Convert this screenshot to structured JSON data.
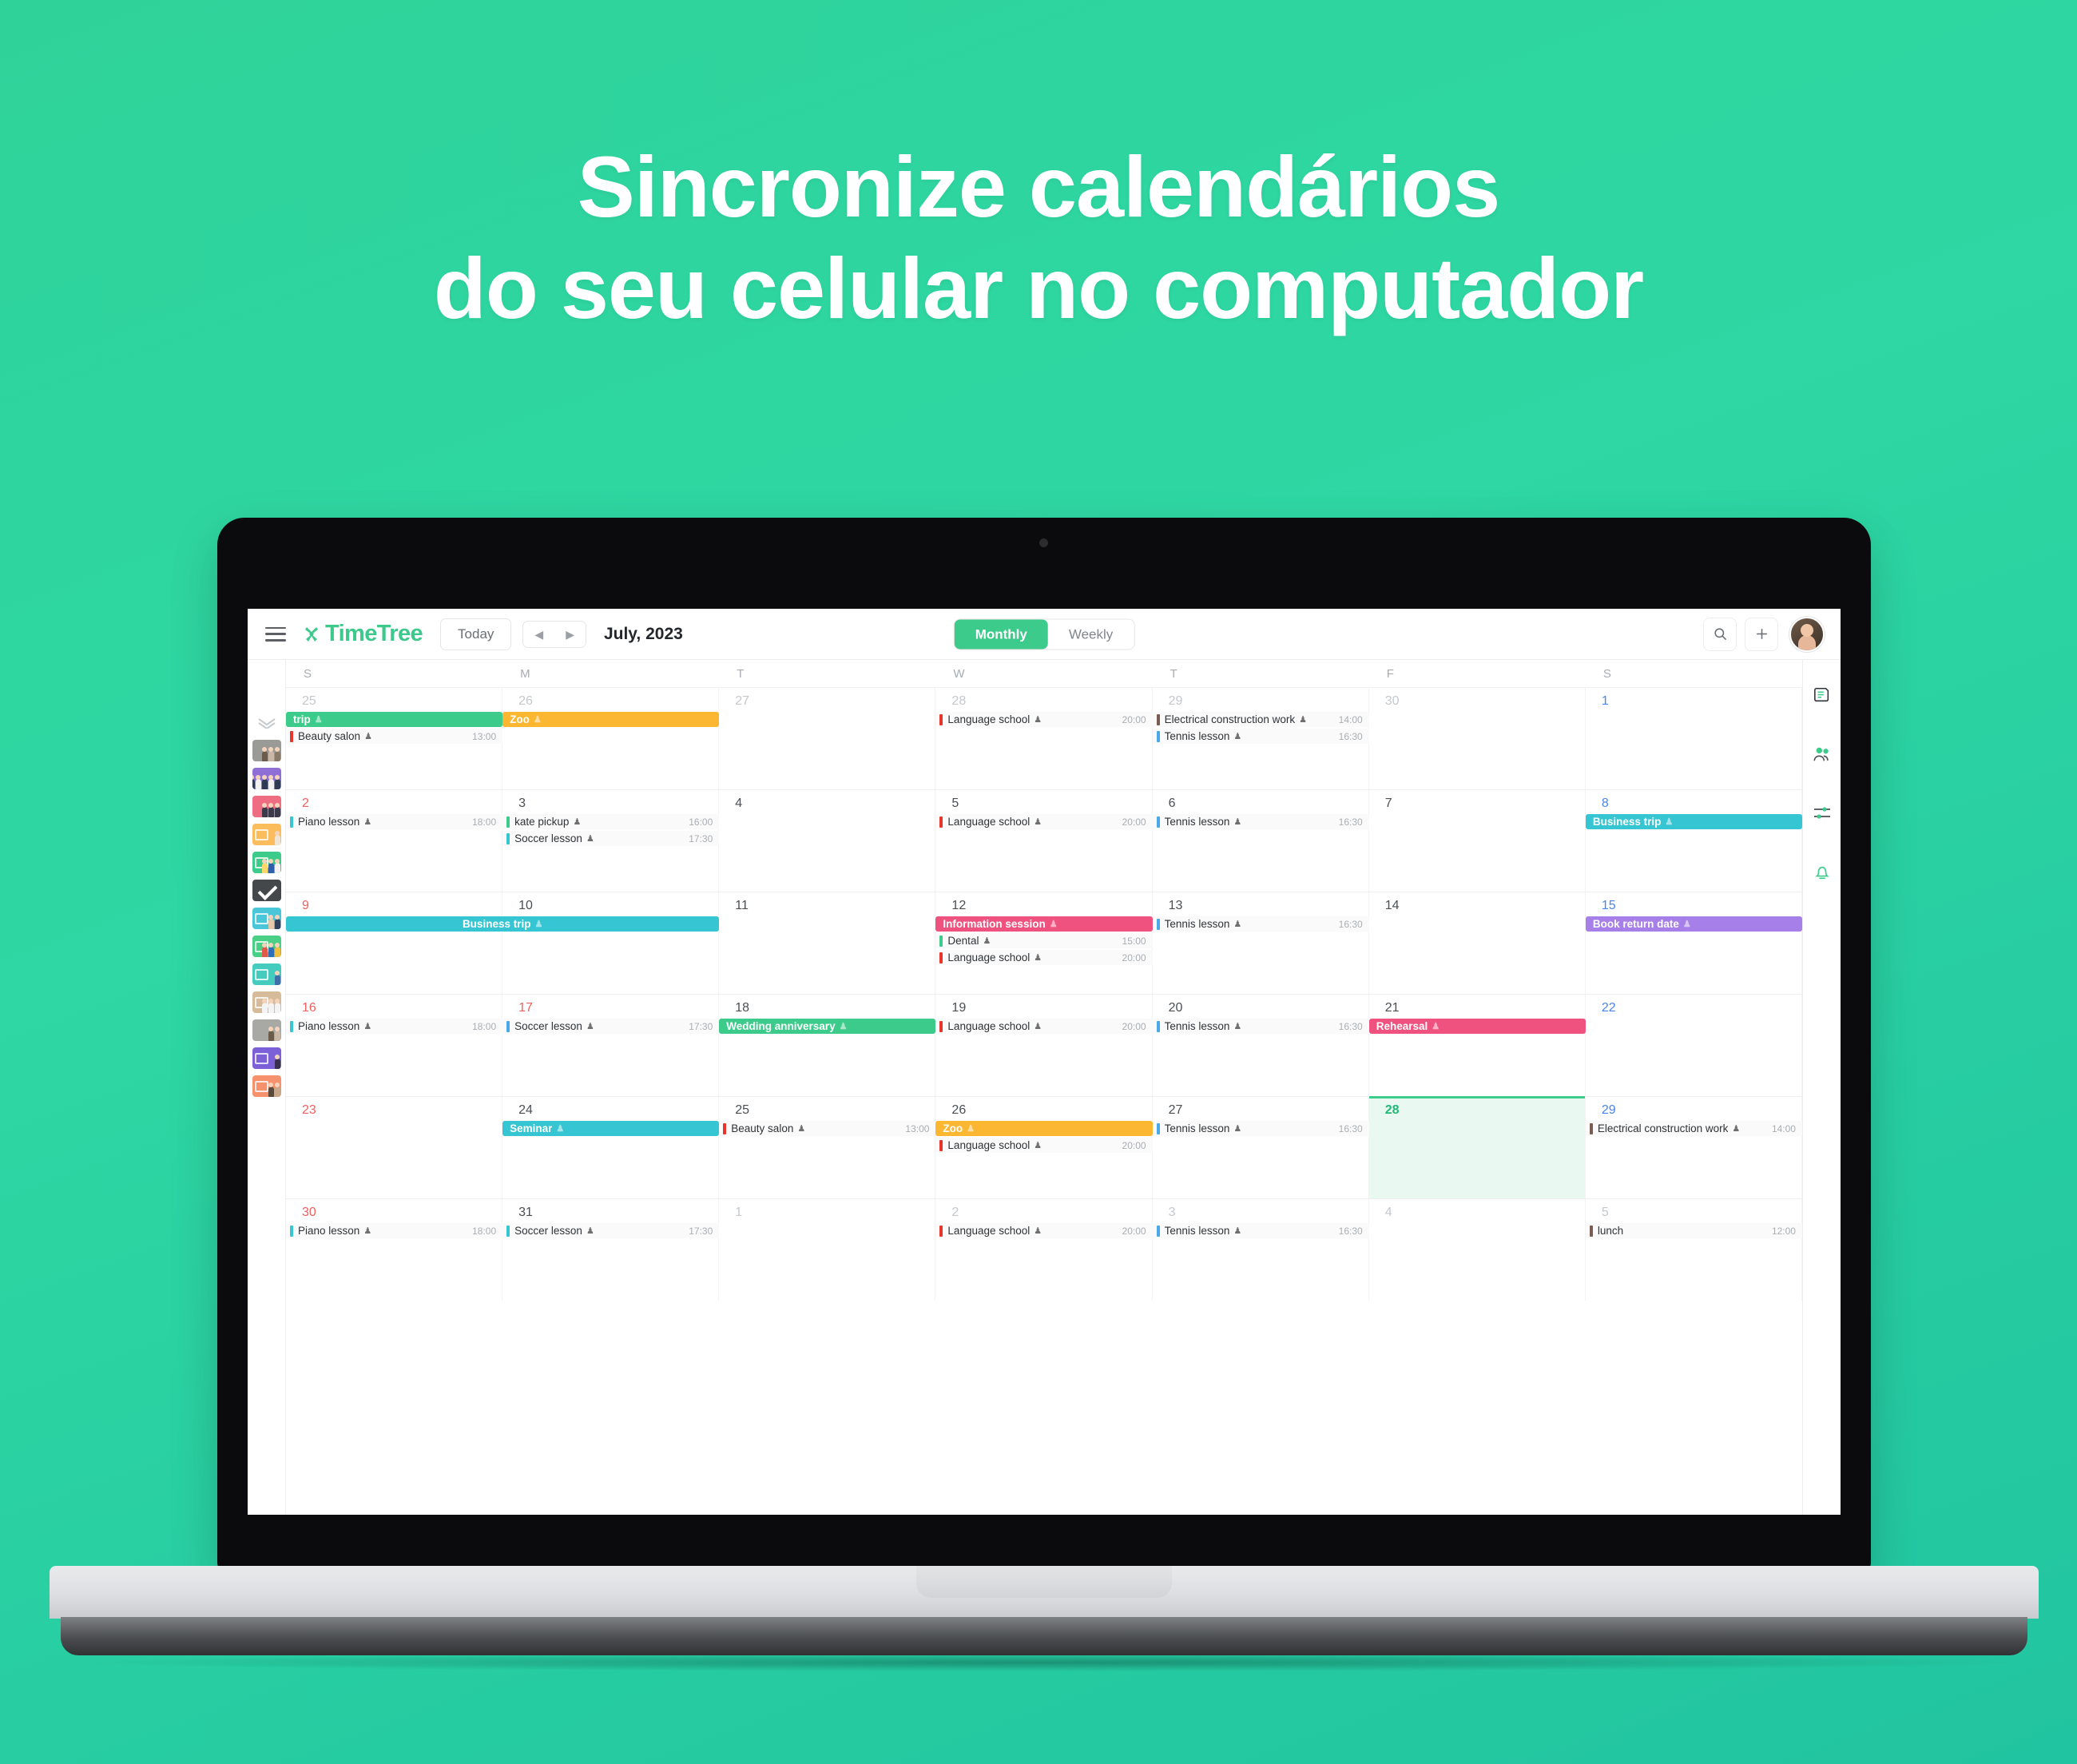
{
  "promo": {
    "line1": "Sincronize calendários",
    "line2": "do seu celular no computador"
  },
  "colors": {
    "background": "#2ed7a3",
    "brand_green": "#3ec98c",
    "accent_active": "#3ccb8b",
    "today_bg": "#e9f8f0",
    "event_green": "#3ccb8b",
    "event_orange": "#fbb731",
    "event_teal": "#36c6d3",
    "event_pink": "#f0527f",
    "event_purple": "#a67fe8",
    "event_red": "#e8342a",
    "event_blue": "#4aa8e8",
    "event_brown": "#7a5c52"
  },
  "toolbar": {
    "menu_icon": "hamburger-icon",
    "brand": "TimeTree",
    "today_label": "Today",
    "prev_icon": "chevron-left-icon",
    "next_icon": "chevron-right-icon",
    "month_label": "July, 2023",
    "views": [
      {
        "label": "Monthly",
        "active": true
      },
      {
        "label": "Weekly",
        "active": false
      }
    ],
    "search_icon": "search-icon",
    "add_icon": "plus-icon",
    "avatar": "user-avatar"
  },
  "left_rail": {
    "collapse_icon": "double-chevron-icon",
    "calendars": [
      {
        "name": "family-photo-calendar",
        "bg": "#9a9a97",
        "glyph": false,
        "check": false,
        "people": [
          "#6b5b4b",
          "#c9b8a8",
          "#8a7a6a"
        ]
      },
      {
        "name": "purple-group-calendar",
        "bg": "#8f6fd6",
        "glyph": false,
        "check": false,
        "people": [
          "#2f3b55",
          "#f2f2f2",
          "#2f3b55",
          "#f2f2f2",
          "#2f3b55"
        ]
      },
      {
        "name": "pink-group-calendar",
        "bg": "#ef6d82",
        "glyph": false,
        "check": false,
        "people": [
          "#3a3a4a",
          "#3a3a4a",
          "#3a3a4a"
        ]
      },
      {
        "name": "orange-work-calendar",
        "bg": "#fbbd5b",
        "glyph": true,
        "check": false,
        "people": [
          "#efe5d2"
        ]
      },
      {
        "name": "green-home-calendar",
        "bg": "#3ccb8b",
        "glyph": true,
        "check": false,
        "people": [
          "#ffd86b",
          "#2f5fa8",
          "#f2f2f2"
        ]
      },
      {
        "name": "selected-dark-calendar",
        "bg": "#45484a",
        "glyph": false,
        "check": true,
        "people": []
      },
      {
        "name": "teal-team-calendar",
        "bg": "#49c7d8",
        "glyph": true,
        "check": false,
        "people": [
          "#e6c9a8",
          "#30415c"
        ]
      },
      {
        "name": "green-friends-calendar",
        "bg": "#49cf86",
        "glyph": true,
        "check": false,
        "people": [
          "#e05a4a",
          "#2f6fb8",
          "#f0c040"
        ]
      },
      {
        "name": "teal-work-calendar",
        "bg": "#46cbbf",
        "glyph": true,
        "check": false,
        "people": [
          "#3f6fa8"
        ]
      },
      {
        "name": "beige-class-calendar",
        "bg": "#d6bb9a",
        "glyph": true,
        "check": false,
        "people": [
          "#f4f4f4",
          "#f4f4f4",
          "#f4f4f4"
        ]
      },
      {
        "name": "street-photo-calendar",
        "bg": "#a8a8a4",
        "glyph": false,
        "check": false,
        "people": [
          "#6b5b4b",
          "#c9b8a8"
        ]
      },
      {
        "name": "purple-idea-calendar",
        "bg": "#7b60d8",
        "glyph": true,
        "check": false,
        "people": [
          "#3a3050"
        ]
      },
      {
        "name": "salmon-music-calendar",
        "bg": "#f5916c",
        "glyph": true,
        "check": false,
        "people": [
          "#5a4a3a",
          "#c9a88a"
        ]
      }
    ]
  },
  "right_rail": {
    "icons": [
      "memo-icon",
      "people-icon",
      "sliders-icon",
      "bell-icon"
    ]
  },
  "calendar": {
    "day_headers": [
      "S",
      "M",
      "T",
      "W",
      "T",
      "F",
      "S"
    ],
    "weeks": [
      {
        "days": [
          {
            "num": "25",
            "kind": "other-sun"
          },
          {
            "num": "26",
            "kind": "other"
          },
          {
            "num": "27",
            "kind": "other"
          },
          {
            "num": "28",
            "kind": "other"
          },
          {
            "num": "29",
            "kind": "other"
          },
          {
            "num": "30",
            "kind": "other"
          },
          {
            "num": "1",
            "kind": "sat"
          }
        ],
        "events": [
          {
            "title": "trip",
            "style": "bar",
            "color": "#3ccb8b",
            "start": 0,
            "span": 1,
            "row": 0,
            "time": "",
            "shared": true
          },
          {
            "title": "Zoo",
            "style": "bar",
            "color": "#fbb731",
            "start": 1,
            "span": 1,
            "row": 0,
            "time": "",
            "shared": true
          },
          {
            "title": "Language school",
            "style": "plain",
            "color": "#e8342a",
            "start": 3,
            "span": 1,
            "row": 0,
            "time": "20:00",
            "shared": true
          },
          {
            "title": "Electrical construction work",
            "style": "plain",
            "color": "#7a5c52",
            "start": 4,
            "span": 1,
            "row": 0,
            "time": "14:00",
            "shared": true
          },
          {
            "title": "Beauty salon",
            "style": "plain",
            "color": "#e8342a",
            "start": 0,
            "span": 1,
            "row": 1,
            "time": "13:00",
            "shared": true
          },
          {
            "title": "Tennis lesson",
            "style": "plain",
            "color": "#4aa8e8",
            "start": 4,
            "span": 1,
            "row": 1,
            "time": "16:30",
            "shared": true
          }
        ]
      },
      {
        "days": [
          {
            "num": "2",
            "kind": "sun"
          },
          {
            "num": "3",
            "kind": "normal"
          },
          {
            "num": "4",
            "kind": "normal"
          },
          {
            "num": "5",
            "kind": "normal"
          },
          {
            "num": "6",
            "kind": "normal"
          },
          {
            "num": "7",
            "kind": "normal"
          },
          {
            "num": "8",
            "kind": "sat"
          }
        ],
        "events": [
          {
            "title": "Piano lesson",
            "style": "plain",
            "color": "#36c6d3",
            "start": 0,
            "span": 1,
            "row": 0,
            "time": "18:00",
            "shared": true
          },
          {
            "title": "kate pickup",
            "style": "plain",
            "color": "#3ccb8b",
            "start": 1,
            "span": 1,
            "row": 0,
            "time": "16:00",
            "shared": true
          },
          {
            "title": "Language school",
            "style": "plain",
            "color": "#e8342a",
            "start": 3,
            "span": 1,
            "row": 0,
            "time": "20:00",
            "shared": true
          },
          {
            "title": "Tennis lesson",
            "style": "plain",
            "color": "#4aa8e8",
            "start": 4,
            "span": 1,
            "row": 0,
            "time": "16:30",
            "shared": true
          },
          {
            "title": "Business trip",
            "style": "bar",
            "color": "#36c6d3",
            "start": 6,
            "span": 1,
            "row": 0,
            "time": "",
            "shared": true
          },
          {
            "title": "Soccer lesson",
            "style": "plain",
            "color": "#36c6d3",
            "start": 1,
            "span": 1,
            "row": 1,
            "time": "17:30",
            "shared": true
          }
        ]
      },
      {
        "days": [
          {
            "num": "9",
            "kind": "sun"
          },
          {
            "num": "10",
            "kind": "normal"
          },
          {
            "num": "11",
            "kind": "normal"
          },
          {
            "num": "12",
            "kind": "normal"
          },
          {
            "num": "13",
            "kind": "normal"
          },
          {
            "num": "14",
            "kind": "normal"
          },
          {
            "num": "15",
            "kind": "sat"
          }
        ],
        "events": [
          {
            "title": "Business trip",
            "style": "bar-center",
            "color": "#36c6d3",
            "start": 0,
            "span": 2,
            "row": 0,
            "time": "",
            "shared": true
          },
          {
            "title": "Information session",
            "style": "bar",
            "color": "#f0527f",
            "start": 3,
            "span": 1,
            "row": 0,
            "time": "",
            "shared": true
          },
          {
            "title": "Tennis lesson",
            "style": "plain",
            "color": "#4aa8e8",
            "start": 4,
            "span": 1,
            "row": 0,
            "time": "16:30",
            "shared": true
          },
          {
            "title": "Book return date",
            "style": "bar",
            "color": "#a67fe8",
            "start": 6,
            "span": 1,
            "row": 0,
            "time": "",
            "shared": true
          },
          {
            "title": "Dental",
            "style": "plain",
            "color": "#3ccb8b",
            "start": 3,
            "span": 1,
            "row": 1,
            "time": "15:00",
            "shared": true
          },
          {
            "title": "Language school",
            "style": "plain",
            "color": "#e8342a",
            "start": 3,
            "span": 1,
            "row": 2,
            "time": "20:00",
            "shared": true
          }
        ]
      },
      {
        "days": [
          {
            "num": "16",
            "kind": "sun"
          },
          {
            "num": "17",
            "kind": "sun"
          },
          {
            "num": "18",
            "kind": "normal"
          },
          {
            "num": "19",
            "kind": "normal"
          },
          {
            "num": "20",
            "kind": "normal"
          },
          {
            "num": "21",
            "kind": "normal"
          },
          {
            "num": "22",
            "kind": "sat"
          }
        ],
        "events": [
          {
            "title": "Piano lesson",
            "style": "plain",
            "color": "#36c6d3",
            "start": 0,
            "span": 1,
            "row": 0,
            "time": "18:00",
            "shared": true
          },
          {
            "title": "Soccer lesson",
            "style": "plain",
            "color": "#4aa8e8",
            "start": 1,
            "span": 1,
            "row": 0,
            "time": "17:30",
            "shared": true
          },
          {
            "title": "Wedding anniversary",
            "style": "bar",
            "color": "#3ccb8b",
            "start": 2,
            "span": 1,
            "row": 0,
            "time": "",
            "shared": true
          },
          {
            "title": "Language school",
            "style": "plain",
            "color": "#e8342a",
            "start": 3,
            "span": 1,
            "row": 0,
            "time": "20:00",
            "shared": true
          },
          {
            "title": "Tennis lesson",
            "style": "plain",
            "color": "#4aa8e8",
            "start": 4,
            "span": 1,
            "row": 0,
            "time": "16:30",
            "shared": true
          },
          {
            "title": "Rehearsal",
            "style": "bar",
            "color": "#f0527f",
            "start": 5,
            "span": 1,
            "row": 0,
            "time": "",
            "shared": true
          }
        ]
      },
      {
        "days": [
          {
            "num": "23",
            "kind": "sun"
          },
          {
            "num": "24",
            "kind": "normal"
          },
          {
            "num": "25",
            "kind": "normal"
          },
          {
            "num": "26",
            "kind": "normal"
          },
          {
            "num": "27",
            "kind": "normal"
          },
          {
            "num": "28",
            "kind": "today"
          },
          {
            "num": "29",
            "kind": "sat"
          }
        ],
        "events": [
          {
            "title": "Seminar",
            "style": "bar",
            "color": "#36c6d3",
            "start": 1,
            "span": 1,
            "row": 0,
            "time": "",
            "shared": true
          },
          {
            "title": "Beauty salon",
            "style": "plain",
            "color": "#e8342a",
            "start": 2,
            "span": 1,
            "row": 0,
            "time": "13:00",
            "shared": true
          },
          {
            "title": "Zoo",
            "style": "bar",
            "color": "#fbb731",
            "start": 3,
            "span": 1,
            "row": 0,
            "time": "",
            "shared": true
          },
          {
            "title": "Tennis lesson",
            "style": "plain",
            "color": "#4aa8e8",
            "start": 4,
            "span": 1,
            "row": 0,
            "time": "16:30",
            "shared": true
          },
          {
            "title": "Electrical construction work",
            "style": "plain",
            "color": "#7a5c52",
            "start": 6,
            "span": 1,
            "row": 0,
            "time": "14:00",
            "shared": true
          },
          {
            "title": "Language school",
            "style": "plain",
            "color": "#e8342a",
            "start": 3,
            "span": 1,
            "row": 1,
            "time": "20:00",
            "shared": true
          }
        ]
      },
      {
        "days": [
          {
            "num": "30",
            "kind": "sun"
          },
          {
            "num": "31",
            "kind": "normal"
          },
          {
            "num": "1",
            "kind": "other"
          },
          {
            "num": "2",
            "kind": "other"
          },
          {
            "num": "3",
            "kind": "other"
          },
          {
            "num": "4",
            "kind": "other"
          },
          {
            "num": "5",
            "kind": "other-sat"
          }
        ],
        "events": [
          {
            "title": "Piano lesson",
            "style": "plain",
            "color": "#36c6d3",
            "start": 0,
            "span": 1,
            "row": 0,
            "time": "18:00",
            "shared": true
          },
          {
            "title": "Soccer lesson",
            "style": "plain",
            "color": "#36c6d3",
            "start": 1,
            "span": 1,
            "row": 0,
            "time": "17:30",
            "shared": true
          },
          {
            "title": "Language school",
            "style": "plain",
            "color": "#e8342a",
            "start": 3,
            "span": 1,
            "row": 0,
            "time": "20:00",
            "shared": true
          },
          {
            "title": "Tennis lesson",
            "style": "plain",
            "color": "#4aa8e8",
            "start": 4,
            "span": 1,
            "row": 0,
            "time": "16:30",
            "shared": true
          },
          {
            "title": "lunch",
            "style": "plain",
            "color": "#7a5c52",
            "start": 6,
            "span": 1,
            "row": 0,
            "time": "12:00",
            "shared": false
          }
        ]
      }
    ]
  }
}
